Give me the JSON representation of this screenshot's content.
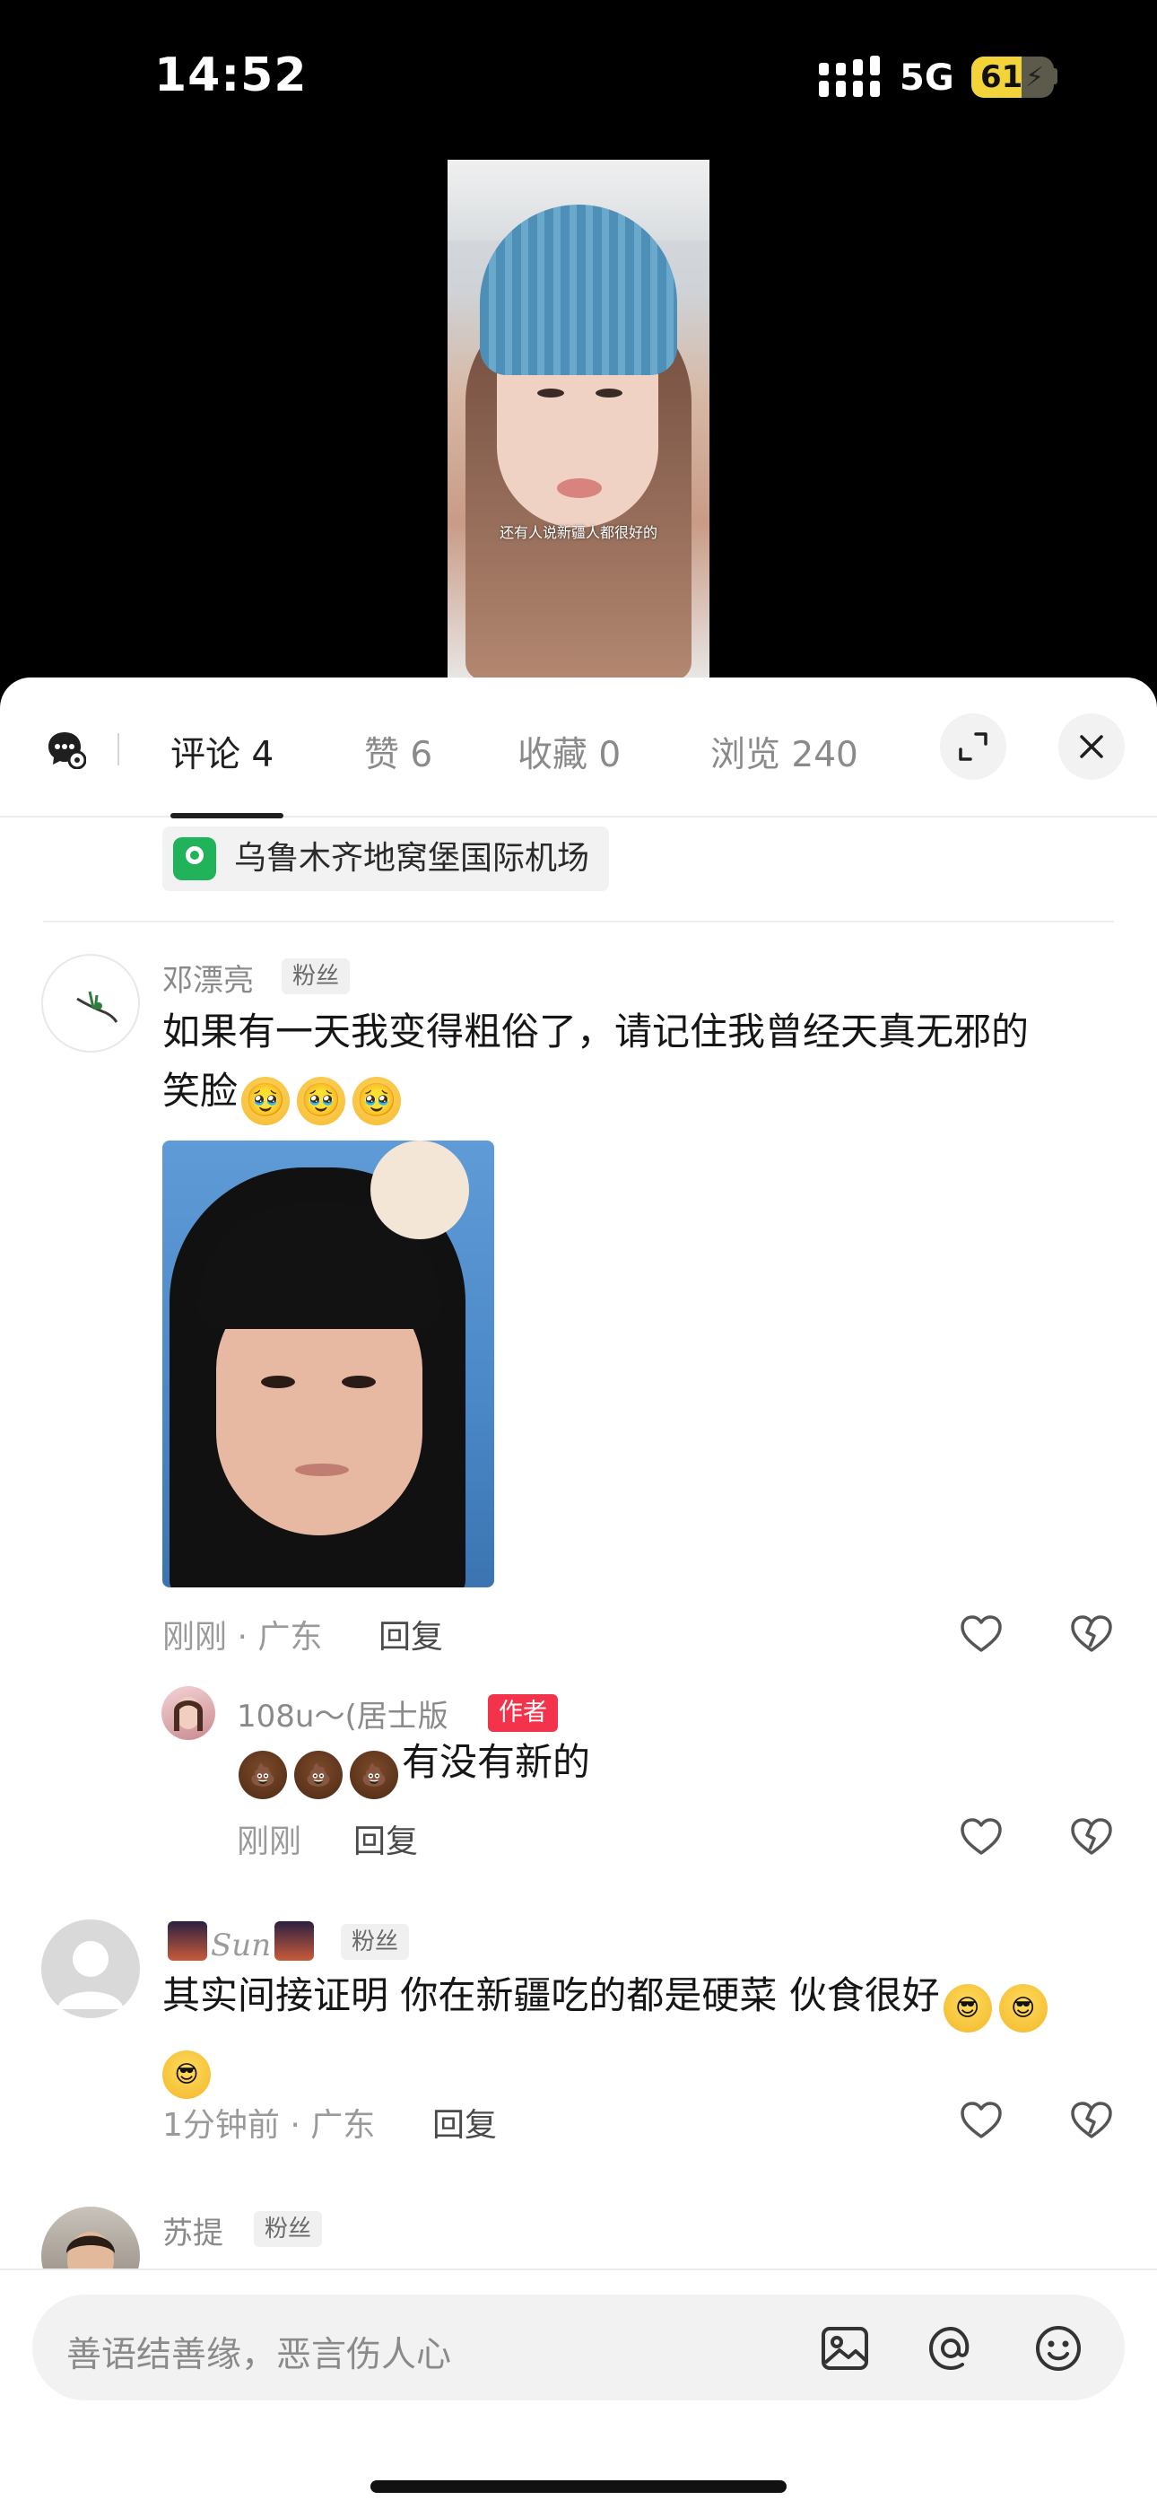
{
  "status_bar": {
    "time": "14:52",
    "network": "5G",
    "battery": "61",
    "battery_level": 0.61
  },
  "video": {
    "caption": "还有人说新疆人都很好的"
  },
  "header": {
    "tabs": [
      {
        "label": "评论 4",
        "active": true
      },
      {
        "label": "赞 6",
        "active": false
      },
      {
        "label": "收藏 0",
        "active": false
      },
      {
        "label": "浏览 240",
        "active": false
      }
    ],
    "icons": {
      "ai": "ai-chat-icon",
      "expand": "expand-icon",
      "close": "close-icon"
    }
  },
  "location": {
    "name": "乌鲁木齐地窝堡国际机场",
    "icon": "location-pin-icon",
    "color": "#21b35a"
  },
  "comments": [
    {
      "username": "邓漂亮",
      "badge": "粉丝",
      "text": "如果有一天我变得粗俗了，请记住我曾经天真无邪的",
      "text_line2": "笑脸",
      "emojis": [
        "🥹",
        "🥹",
        "🥹"
      ],
      "has_image": true,
      "meta": "刚刚 · 广东",
      "reply_label": "回复",
      "replies": [
        {
          "username": "108u～(居士版",
          "badge": "作者",
          "emojis": [
            "💩",
            "💩",
            "💩"
          ],
          "text": "有没有新的",
          "meta": "刚刚",
          "reply_label": "回复"
        }
      ]
    },
    {
      "username": "Sun",
      "badge": "粉丝",
      "text": "其实间接证明 你在新疆吃的都是硬菜 伙食很好",
      "emojis": [
        "😎",
        "😎",
        "😎"
      ],
      "meta": "1分钟前 · 广东",
      "reply_label": "回复"
    },
    {
      "username": "苏提",
      "badge": "粉丝"
    }
  ],
  "input": {
    "placeholder": "善语结善缘，恶言伤人心",
    "icons": [
      "image-icon",
      "at-icon",
      "emoji-icon"
    ]
  },
  "colors": {
    "author_badge": "#f2334b",
    "battery": "#f2d33a"
  }
}
